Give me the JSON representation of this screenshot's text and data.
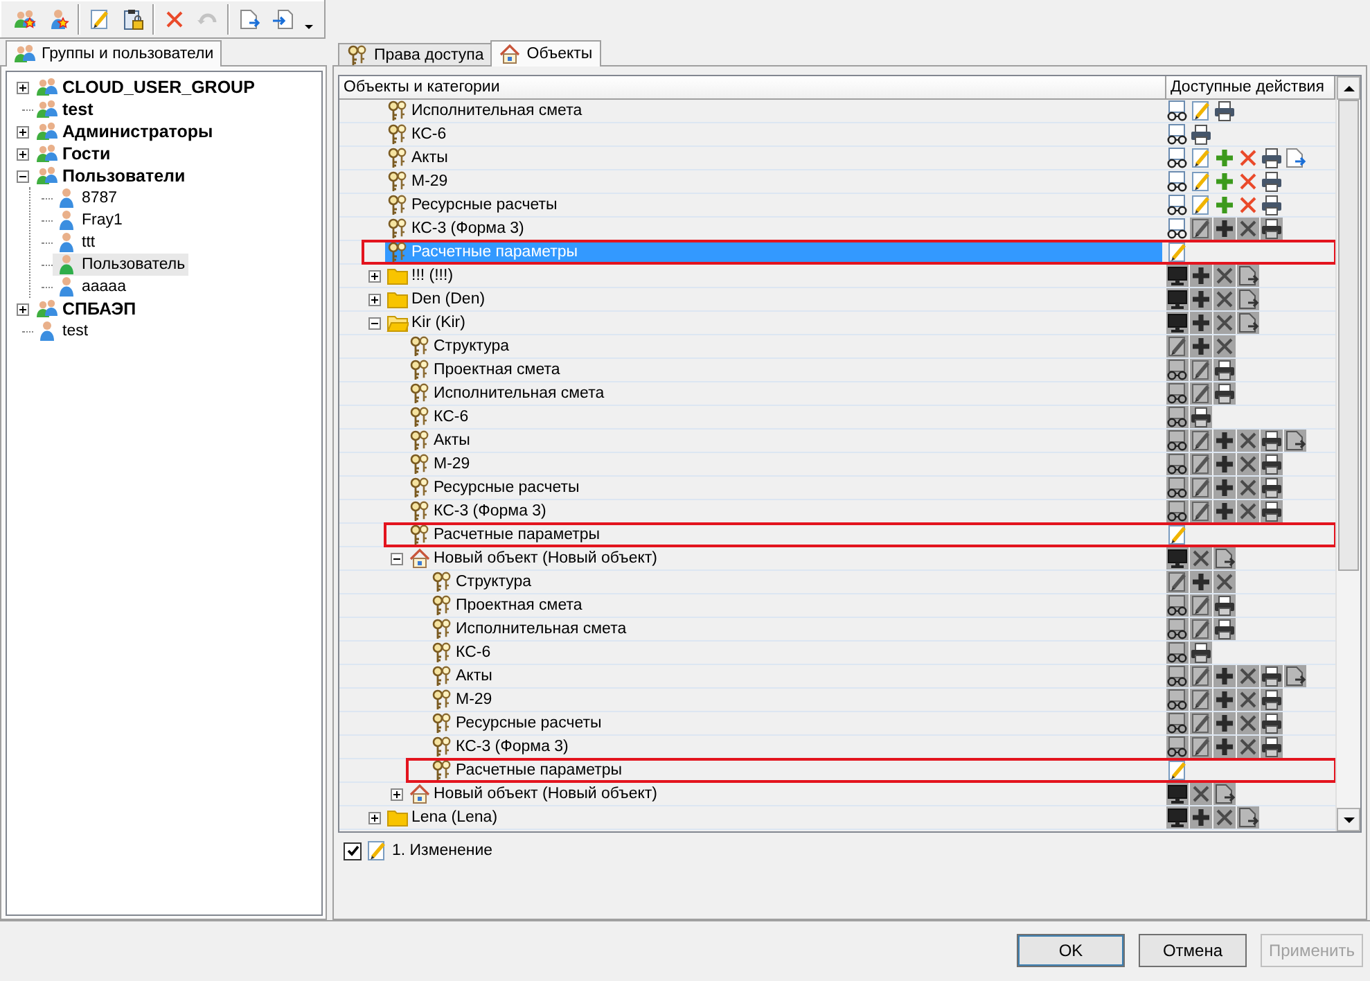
{
  "toolbar_groups": [
    {
      "buttons": [
        {
          "kind": "add-group",
          "disabled": false
        },
        {
          "kind": "add-user",
          "disabled": false
        }
      ]
    },
    {
      "buttons": [
        {
          "kind": "edit",
          "disabled": false
        },
        {
          "kind": "properties",
          "disabled": false
        }
      ]
    },
    {
      "buttons": [
        {
          "kind": "delete",
          "disabled": false
        },
        {
          "kind": "undo",
          "disabled": true
        }
      ]
    },
    {
      "buttons": [
        {
          "kind": "import",
          "disabled": false
        },
        {
          "kind": "export",
          "disabled": false
        },
        {
          "kind": "menu",
          "disabled": false
        }
      ]
    }
  ],
  "left_panel": {
    "tabs": [
      {
        "label": "Группы и пользователи",
        "selected": true
      }
    ],
    "tree": [
      {
        "kind": "group",
        "label": "CLOUD_USER_GROUP",
        "selected": false,
        "expanded": false
      },
      {
        "kind": "group",
        "label": "test",
        "selected": false
      },
      {
        "kind": "group",
        "label": "Администраторы",
        "selected": false,
        "expanded": false
      },
      {
        "kind": "group",
        "label": "Гости",
        "selected": false,
        "expanded": false
      },
      {
        "kind": "group",
        "label": "Пользователи",
        "selected": false,
        "expanded": true,
        "children": [
          {
            "kind": "user",
            "label": "8787",
            "selected": false,
            "color": "#3b8ee0"
          },
          {
            "kind": "user",
            "label": "Fray1",
            "selected": false,
            "color": "#3b8ee0"
          },
          {
            "kind": "user",
            "label": "ttt",
            "selected": false,
            "color": "#3b8ee0"
          },
          {
            "kind": "user",
            "label": "Пользователь",
            "selected": true,
            "color": "#2fae4a"
          },
          {
            "kind": "user",
            "label": "aaaaa",
            "selected": false,
            "color": "#3b8ee0"
          }
        ]
      },
      {
        "kind": "group",
        "label": "СПБАЭП",
        "selected": false,
        "expanded": false
      },
      {
        "kind": "user",
        "label": "test",
        "selected": false,
        "color": "#3b8ee0"
      }
    ]
  },
  "right_panel": {
    "tabs": [
      {
        "label": "Права доступа",
        "kind": "keys",
        "selected": false
      },
      {
        "label": "Объекты",
        "kind": "house",
        "selected": true
      }
    ],
    "grid": {
      "columns": [
        "Объекты и категории",
        "Доступные действия"
      ],
      "rows": [
        {
          "kind": "category",
          "label": "Исполнительная смета",
          "selected": false,
          "outlined": false,
          "actions": [
            {
              "kind": "view",
              "greyed": false
            },
            {
              "kind": "edit",
              "greyed": false
            },
            {
              "kind": "print",
              "greyed": false
            }
          ]
        },
        {
          "kind": "category",
          "label": "КС-6",
          "selected": false,
          "outlined": false,
          "actions": [
            {
              "kind": "view",
              "greyed": false
            },
            {
              "kind": "print",
              "greyed": false
            }
          ]
        },
        {
          "kind": "category",
          "label": "Акты",
          "selected": false,
          "outlined": false,
          "actions": [
            {
              "kind": "view",
              "greyed": false
            },
            {
              "kind": "edit",
              "greyed": false
            },
            {
              "kind": "add",
              "greyed": false
            },
            {
              "kind": "delete",
              "greyed": false
            },
            {
              "kind": "print",
              "greyed": false
            },
            {
              "kind": "export",
              "greyed": false
            }
          ]
        },
        {
          "kind": "category",
          "label": "М-29",
          "selected": false,
          "outlined": false,
          "actions": [
            {
              "kind": "view",
              "greyed": false
            },
            {
              "kind": "edit",
              "greyed": false
            },
            {
              "kind": "add",
              "greyed": false
            },
            {
              "kind": "delete",
              "greyed": false
            },
            {
              "kind": "print",
              "greyed": false
            }
          ]
        },
        {
          "kind": "category",
          "label": "Ресурсные расчеты",
          "selected": false,
          "outlined": false,
          "actions": [
            {
              "kind": "view",
              "greyed": false
            },
            {
              "kind": "edit",
              "greyed": false
            },
            {
              "kind": "add",
              "greyed": false
            },
            {
              "kind": "delete",
              "greyed": false
            },
            {
              "kind": "print",
              "greyed": false
            }
          ]
        },
        {
          "kind": "category",
          "label": "КС-3 (Форма 3)",
          "selected": false,
          "outlined": false,
          "actions": [
            {
              "kind": "view",
              "greyed": false
            },
            {
              "kind": "edit",
              "greyed": true
            },
            {
              "kind": "add",
              "greyed": true
            },
            {
              "kind": "delete",
              "greyed": true
            },
            {
              "kind": "print",
              "greyed": true
            }
          ]
        },
        {
          "kind": "category",
          "label": "Расчетные параметры",
          "selected": true,
          "outlined": true,
          "actions": [
            {
              "kind": "edit",
              "greyed": false
            }
          ]
        },
        {
          "kind": "folder",
          "label": "!!! (!!!)",
          "selected": false,
          "outlined": false,
          "expanded": false,
          "actions": [
            {
              "kind": "monitor",
              "greyed": true
            },
            {
              "kind": "add",
              "greyed": true
            },
            {
              "kind": "delete",
              "greyed": true
            },
            {
              "kind": "export",
              "greyed": true
            }
          ]
        },
        {
          "kind": "folder",
          "label": "Den (Den)",
          "selected": false,
          "outlined": false,
          "expanded": false,
          "actions": [
            {
              "kind": "monitor",
              "greyed": true
            },
            {
              "kind": "add",
              "greyed": true
            },
            {
              "kind": "delete",
              "greyed": true
            },
            {
              "kind": "export",
              "greyed": true
            }
          ]
        },
        {
          "kind": "folder",
          "label": "Kir (Kir)",
          "selected": false,
          "outlined": false,
          "expanded": true,
          "actions": [
            {
              "kind": "monitor",
              "greyed": true
            },
            {
              "kind": "add",
              "greyed": true
            },
            {
              "kind": "delete",
              "greyed": true
            },
            {
              "kind": "export",
              "greyed": true
            }
          ],
          "children": [
            {
              "kind": "category",
              "label": "Структура",
              "selected": false,
              "outlined": false,
              "actions": [
                {
                  "kind": "edit",
                  "greyed": true
                },
                {
                  "kind": "add",
                  "greyed": true
                },
                {
                  "kind": "delete",
                  "greyed": true
                }
              ]
            },
            {
              "kind": "category",
              "label": "Проектная смета",
              "selected": false,
              "outlined": false,
              "actions": [
                {
                  "kind": "view",
                  "greyed": true
                },
                {
                  "kind": "edit",
                  "greyed": true
                },
                {
                  "kind": "print",
                  "greyed": true
                }
              ]
            },
            {
              "kind": "category",
              "label": "Исполнительная смета",
              "selected": false,
              "outlined": false,
              "actions": [
                {
                  "kind": "view",
                  "greyed": true
                },
                {
                  "kind": "edit",
                  "greyed": true
                },
                {
                  "kind": "print",
                  "greyed": true
                }
              ]
            },
            {
              "kind": "category",
              "label": "КС-6",
              "selected": false,
              "outlined": false,
              "actions": [
                {
                  "kind": "view",
                  "greyed": true
                },
                {
                  "kind": "print",
                  "greyed": true
                }
              ]
            },
            {
              "kind": "category",
              "label": "Акты",
              "selected": false,
              "outlined": false,
              "actions": [
                {
                  "kind": "view",
                  "greyed": true
                },
                {
                  "kind": "edit",
                  "greyed": true
                },
                {
                  "kind": "add",
                  "greyed": true
                },
                {
                  "kind": "delete",
                  "greyed": true
                },
                {
                  "kind": "print",
                  "greyed": true
                },
                {
                  "kind": "export",
                  "greyed": true
                }
              ]
            },
            {
              "kind": "category",
              "label": "М-29",
              "selected": false,
              "outlined": false,
              "actions": [
                {
                  "kind": "view",
                  "greyed": true
                },
                {
                  "kind": "edit",
                  "greyed": true
                },
                {
                  "kind": "add",
                  "greyed": true
                },
                {
                  "kind": "delete",
                  "greyed": true
                },
                {
                  "kind": "print",
                  "greyed": true
                }
              ]
            },
            {
              "kind": "category",
              "label": "Ресурсные расчеты",
              "selected": false,
              "outlined": false,
              "actions": [
                {
                  "kind": "view",
                  "greyed": true
                },
                {
                  "kind": "edit",
                  "greyed": true
                },
                {
                  "kind": "add",
                  "greyed": true
                },
                {
                  "kind": "delete",
                  "greyed": true
                },
                {
                  "kind": "print",
                  "greyed": true
                }
              ]
            },
            {
              "kind": "category",
              "label": "КС-3 (Форма 3)",
              "selected": false,
              "outlined": false,
              "actions": [
                {
                  "kind": "view",
                  "greyed": true
                },
                {
                  "kind": "edit",
                  "greyed": true
                },
                {
                  "kind": "add",
                  "greyed": true
                },
                {
                  "kind": "delete",
                  "greyed": true
                },
                {
                  "kind": "print",
                  "greyed": true
                }
              ]
            },
            {
              "kind": "category",
              "label": "Расчетные параметры",
              "selected": false,
              "outlined": true,
              "actions": [
                {
                  "kind": "edit",
                  "greyed": false
                }
              ]
            },
            {
              "kind": "object",
              "label": "Новый объект (Новый объект)",
              "selected": false,
              "outlined": false,
              "expanded": true,
              "actions": [
                {
                  "kind": "monitor",
                  "greyed": true
                },
                {
                  "kind": "delete",
                  "greyed": true
                },
                {
                  "kind": "export",
                  "greyed": true
                }
              ],
              "children": [
                {
                  "kind": "category",
                  "label": "Структура",
                  "selected": false,
                  "outlined": false,
                  "actions": [
                    {
                      "kind": "edit",
                      "greyed": true
                    },
                    {
                      "kind": "add",
                      "greyed": true
                    },
                    {
                      "kind": "delete",
                      "greyed": true
                    }
                  ]
                },
                {
                  "kind": "category",
                  "label": "Проектная смета",
                  "selected": false,
                  "outlined": false,
                  "actions": [
                    {
                      "kind": "view",
                      "greyed": true
                    },
                    {
                      "kind": "edit",
                      "greyed": true
                    },
                    {
                      "kind": "print",
                      "greyed": true
                    }
                  ]
                },
                {
                  "kind": "category",
                  "label": "Исполнительная смета",
                  "selected": false,
                  "outlined": false,
                  "actions": [
                    {
                      "kind": "view",
                      "greyed": true
                    },
                    {
                      "kind": "edit",
                      "greyed": true
                    },
                    {
                      "kind": "print",
                      "greyed": true
                    }
                  ]
                },
                {
                  "kind": "category",
                  "label": "КС-6",
                  "selected": false,
                  "outlined": false,
                  "actions": [
                    {
                      "kind": "view",
                      "greyed": true
                    },
                    {
                      "kind": "print",
                      "greyed": true
                    }
                  ]
                },
                {
                  "kind": "category",
                  "label": "Акты",
                  "selected": false,
                  "outlined": false,
                  "actions": [
                    {
                      "kind": "view",
                      "greyed": true
                    },
                    {
                      "kind": "edit",
                      "greyed": true
                    },
                    {
                      "kind": "add",
                      "greyed": true
                    },
                    {
                      "kind": "delete",
                      "greyed": true
                    },
                    {
                      "kind": "print",
                      "greyed": true
                    },
                    {
                      "kind": "export",
                      "greyed": true
                    }
                  ]
                },
                {
                  "kind": "category",
                  "label": "М-29",
                  "selected": false,
                  "outlined": false,
                  "actions": [
                    {
                      "kind": "view",
                      "greyed": true
                    },
                    {
                      "kind": "edit",
                      "greyed": true
                    },
                    {
                      "kind": "add",
                      "greyed": true
                    },
                    {
                      "kind": "delete",
                      "greyed": true
                    },
                    {
                      "kind": "print",
                      "greyed": true
                    }
                  ]
                },
                {
                  "kind": "category",
                  "label": "Ресурсные расчеты",
                  "selected": false,
                  "outlined": false,
                  "actions": [
                    {
                      "kind": "view",
                      "greyed": true
                    },
                    {
                      "kind": "edit",
                      "greyed": true
                    },
                    {
                      "kind": "add",
                      "greyed": true
                    },
                    {
                      "kind": "delete",
                      "greyed": true
                    },
                    {
                      "kind": "print",
                      "greyed": true
                    }
                  ]
                },
                {
                  "kind": "category",
                  "label": "КС-3 (Форма 3)",
                  "selected": false,
                  "outlined": false,
                  "actions": [
                    {
                      "kind": "view",
                      "greyed": true
                    },
                    {
                      "kind": "edit",
                      "greyed": true
                    },
                    {
                      "kind": "add",
                      "greyed": true
                    },
                    {
                      "kind": "delete",
                      "greyed": true
                    },
                    {
                      "kind": "print",
                      "greyed": true
                    }
                  ]
                },
                {
                  "kind": "category",
                  "label": "Расчетные параметры",
                  "selected": false,
                  "outlined": true,
                  "actions": [
                    {
                      "kind": "edit",
                      "greyed": false
                    }
                  ]
                }
              ]
            },
            {
              "kind": "object",
              "label": "Новый объект (Новый объект)",
              "selected": false,
              "outlined": false,
              "expanded": false,
              "actions": [
                {
                  "kind": "monitor",
                  "greyed": true
                },
                {
                  "kind": "delete",
                  "greyed": true
                },
                {
                  "kind": "export",
                  "greyed": true
                }
              ]
            }
          ]
        },
        {
          "kind": "folder",
          "label": "Lena (Lena)",
          "selected": false,
          "outlined": false,
          "expanded": false,
          "actions": [
            {
              "kind": "monitor",
              "greyed": true
            },
            {
              "kind": "add",
              "greyed": true
            },
            {
              "kind": "delete",
              "greyed": true
            },
            {
              "kind": "export",
              "greyed": true
            }
          ]
        }
      ]
    },
    "legend": [
      {
        "label": "1. Изменение",
        "checked": true
      }
    ]
  },
  "buttons": [
    {
      "label": "OK",
      "disabled": false
    },
    {
      "label": "Отмена",
      "disabled": false
    },
    {
      "label": "Применить",
      "disabled": true
    }
  ]
}
